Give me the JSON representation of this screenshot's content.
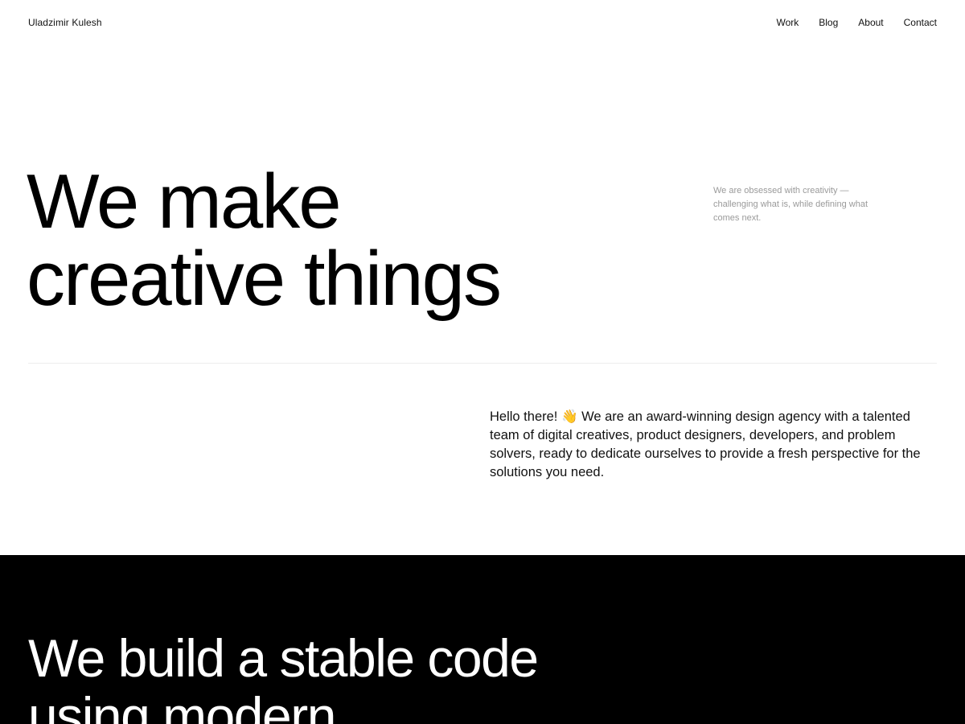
{
  "header": {
    "brand": "Uladzimir Kulesh",
    "nav": [
      "Work",
      "Blog",
      "About",
      "Contact"
    ]
  },
  "hero": {
    "title_lines": [
      "We make",
      "creative things"
    ],
    "tagline": "We are obsessed with creativity — challenging what is, while defining what comes next."
  },
  "intro": {
    "text": "Hello there! 👋 We are an award-winning design agency with a talented team of digital creatives, product designers, developers, and problem solvers, ready to dedicate ourselves to provide a fresh perspective for the solutions you need."
  },
  "services": {
    "title_lines": [
      "We build a stable code",
      "using modern"
    ]
  },
  "colors": {
    "background": "#ffffff",
    "text": "#000000",
    "muted": "#9a9a9a",
    "dark_section": "#000000"
  }
}
